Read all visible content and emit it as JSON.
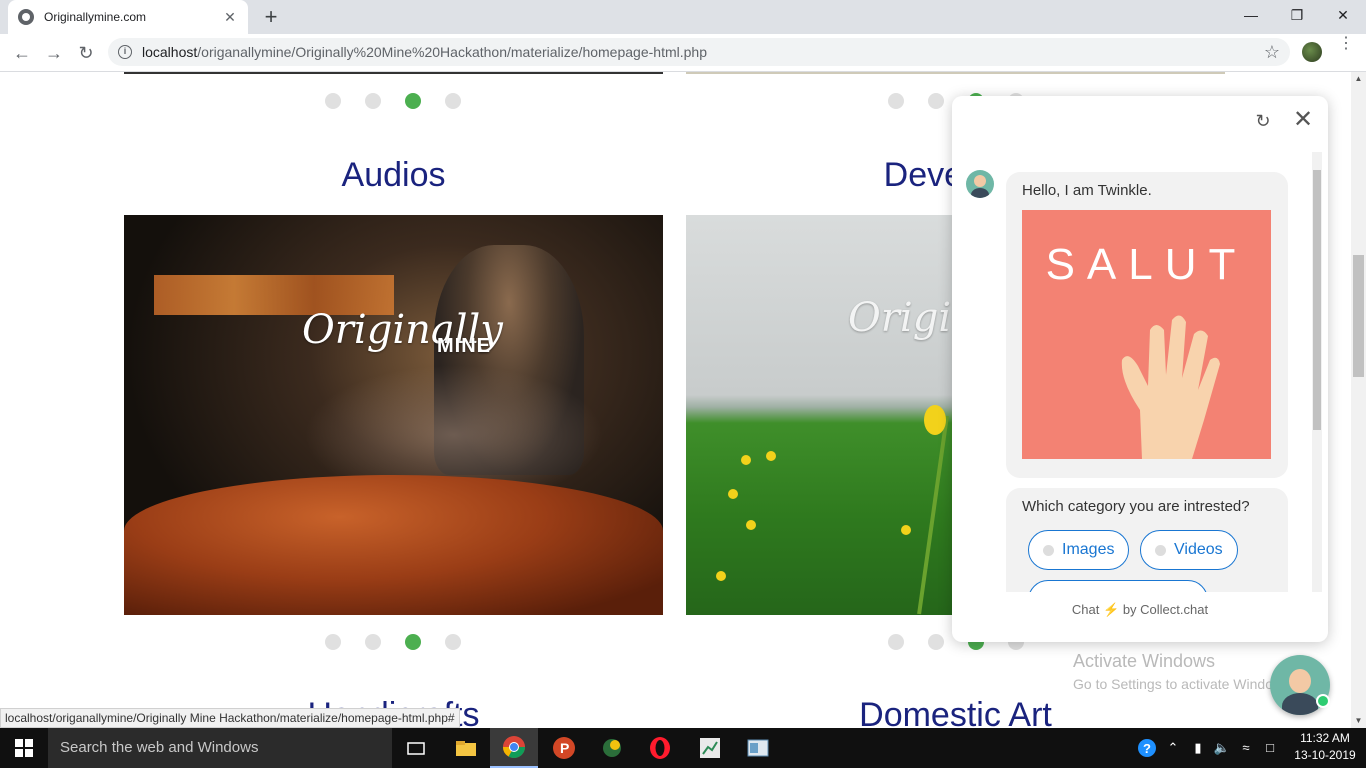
{
  "browser": {
    "tab_title": "Originallymine.com",
    "tab_close": "✕",
    "new_tab": "+",
    "url_host": "localhost",
    "url_path": "/origanallymine/Originally%20Mine%20Hackathon/materialize/homepage-html.php",
    "status_url": "localhost/origanallymine/Originally Mine Hackathon/materialize/homepage-html.php#"
  },
  "sections": {
    "left_title": "Audios",
    "right_title": "Develope",
    "bottom_left_title": "Handicrafts",
    "bottom_right_title": "Domestic Art"
  },
  "watermark": {
    "main": "Originally",
    "sub": "MINE",
    "partial": "Origin"
  },
  "carousel": {
    "active_index": 2,
    "count": 4
  },
  "chat": {
    "greeting": "Hello, I am Twinkle.",
    "image_text": "SALUT",
    "question": "Which category you are intrested?",
    "options": [
      "Images",
      "Videos"
    ],
    "footer_chat": "Chat",
    "footer_by": "by Collect.chat"
  },
  "activate": {
    "title": "Activate Windows",
    "subtitle": "Go to Settings to activate Windows."
  },
  "taskbar": {
    "search_placeholder": "Search the web and Windows",
    "time": "11:32 AM",
    "date": "13-10-2019"
  },
  "colors": {
    "title_blue": "#1a237e",
    "dot_active": "#4caf50",
    "dot_inactive": "#e0e0e0",
    "salut_bg": "#f38273",
    "option_blue": "#1976d2"
  },
  "icons": {
    "back": "arrow-left-icon",
    "forward": "arrow-right-icon",
    "reload": "reload-icon",
    "star": "star-icon",
    "chat_refresh": "refresh-icon",
    "chat_close": "close-icon",
    "windows": "windows-logo-icon",
    "help": "help-icon",
    "wifi": "wifi-icon",
    "volume": "volume-icon",
    "battery": "battery-icon"
  }
}
